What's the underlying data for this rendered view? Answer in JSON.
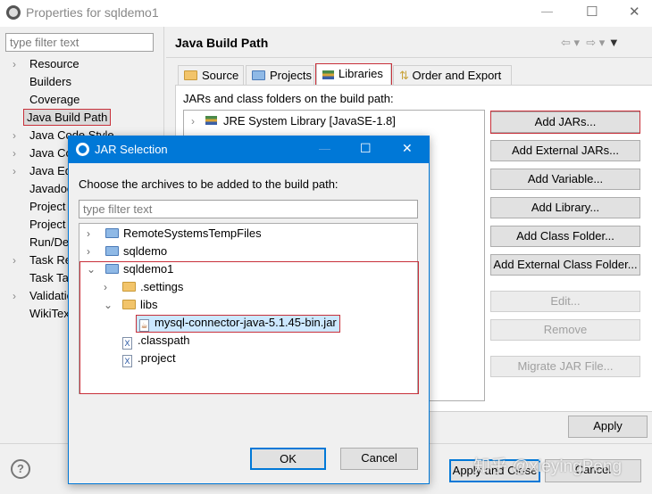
{
  "window": {
    "title": "Properties for sqldemo1",
    "minimize": "—",
    "maximize": "☐",
    "close": "✕"
  },
  "left": {
    "filter_placeholder": "type filter text",
    "items": [
      {
        "label": "Resource",
        "expandable": true
      },
      {
        "label": "Builders",
        "expandable": false
      },
      {
        "label": "Coverage",
        "expandable": false
      },
      {
        "label": "Java Build Path",
        "expandable": false,
        "selected": true
      },
      {
        "label": "Java Code Style",
        "expandable": true
      },
      {
        "label": "Java Compiler",
        "expandable": true
      },
      {
        "label": "Java Editor",
        "expandable": true
      },
      {
        "label": "Javadoc Location",
        "expandable": false
      },
      {
        "label": "Project Facets",
        "expandable": false
      },
      {
        "label": "Project References",
        "expandable": false
      },
      {
        "label": "Run/Debug Settings",
        "expandable": false
      },
      {
        "label": "Task Repository",
        "expandable": true
      },
      {
        "label": "Task Tags",
        "expandable": false
      },
      {
        "label": "Validation",
        "expandable": true
      },
      {
        "label": "WikiText",
        "expandable": false
      }
    ]
  },
  "page": {
    "title": "Java Build Path",
    "tabs": [
      "Source",
      "Projects",
      "Libraries",
      "Order and Export"
    ],
    "active_tab": "Libraries",
    "jars_label": "JARs and class folders on the build path:",
    "libraries": [
      "JRE System Library [JavaSE-1.8]"
    ],
    "buttons": [
      {
        "label": "Add JARs...",
        "enabled": true
      },
      {
        "label": "Add External JARs...",
        "enabled": true
      },
      {
        "label": "Add Variable...",
        "enabled": true
      },
      {
        "label": "Add Library...",
        "enabled": true
      },
      {
        "label": "Add Class Folder...",
        "enabled": true
      },
      {
        "label": "Add External Class Folder...",
        "enabled": true
      },
      {
        "label": "Edit...",
        "enabled": false
      },
      {
        "label": "Remove",
        "enabled": false
      },
      {
        "label": "Migrate JAR File...",
        "enabled": false
      }
    ],
    "apply": "Apply"
  },
  "footer": {
    "help": "?",
    "apply_close": "Apply and Close",
    "cancel": "Cancel"
  },
  "dialog": {
    "title": "JAR Selection",
    "prompt": "Choose the archives to be added to the build path:",
    "filter_placeholder": "type filter text",
    "tree": [
      "RemoteSystemsTempFiles",
      "sqldemo",
      "sqldemo1",
      ".settings",
      "libs",
      "mysql-connector-java-5.1.45-bin.jar",
      ".classpath",
      ".project"
    ],
    "ok": "OK",
    "cancel": "Cancel"
  },
  "watermark": "知乎 @xieyingPeng",
  "colors": {
    "accent": "#0078d7",
    "highlight": "#c8303a",
    "selection": "#cce8ff"
  }
}
